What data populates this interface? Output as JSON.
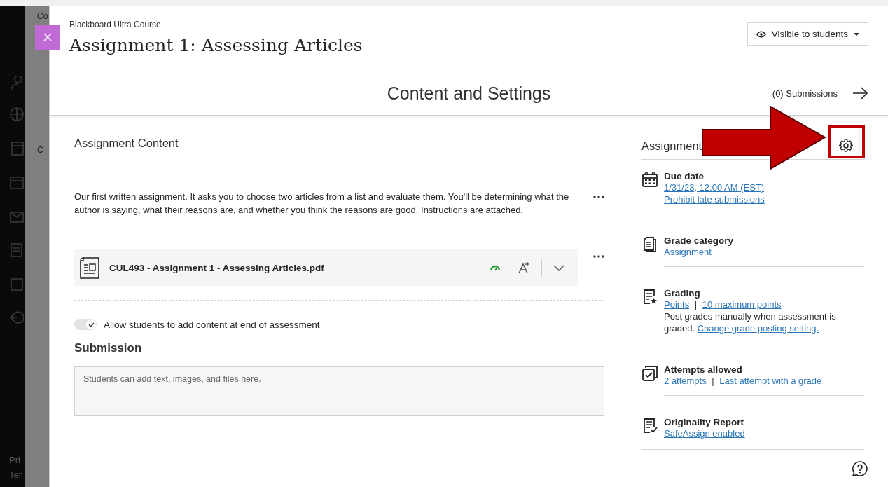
{
  "background_page": {
    "title_fragment": "Co",
    "section_fragment": "C",
    "footer_fragments": [
      "Pri",
      "Ter"
    ]
  },
  "header": {
    "course": "Blackboard Ultra Course",
    "title": "Assignment 1: Assessing Articles",
    "visibility": "Visible to students"
  },
  "subheader": {
    "title": "Content and Settings",
    "submissions": "(0) Submissions"
  },
  "content": {
    "heading": "Assignment Content",
    "description": "Our first written assignment. It asks you to choose two articles from a list and evaluate them. You'll be determining what the author is saying, what their reasons are, and whether you think the reasons are good. Instructions are attached.",
    "attachment": {
      "name": "CUL493 - Assignment 1 - Assessing Articles.pdf"
    },
    "allow_toggle": {
      "label": "Allow students to add content at end of assessment",
      "on": true
    },
    "submission": {
      "heading": "Submission",
      "placeholder": "Students can add text, images, and files here."
    }
  },
  "details": {
    "heading": "Assignment",
    "items": [
      {
        "kind": "calendar",
        "title": "Due date",
        "lines": [
          [
            {
              "text": "1/31/23, 12:00 AM (EST)",
              "link": true
            }
          ],
          [
            {
              "text": "Prohibit late submissions",
              "link": true
            }
          ]
        ]
      },
      {
        "kind": "document",
        "title": "Grade category",
        "lines": [
          [
            {
              "text": "Assignment",
              "link": true
            }
          ]
        ]
      },
      {
        "kind": "grading",
        "title": "Grading",
        "lines": [
          [
            {
              "text": "Points",
              "link": true
            },
            {
              "text": "|",
              "link": false
            },
            {
              "text": "10 maximum points",
              "link": true
            }
          ],
          [
            {
              "text": "Post grades manually when assessment is graded.",
              "link": false
            },
            {
              "text": "Change grade posting setting.",
              "link": true
            }
          ]
        ]
      },
      {
        "kind": "attempts",
        "title": "Attempts allowed",
        "lines": [
          [
            {
              "text": "2 attempts",
              "link": true
            },
            {
              "text": "|",
              "link": false
            },
            {
              "text": "Last attempt with a grade",
              "link": true
            }
          ]
        ]
      },
      {
        "kind": "originality",
        "title": "Originality Report",
        "lines": [
          [
            {
              "text": "SafeAssign enabled",
              "link": true
            }
          ]
        ]
      }
    ]
  }
}
